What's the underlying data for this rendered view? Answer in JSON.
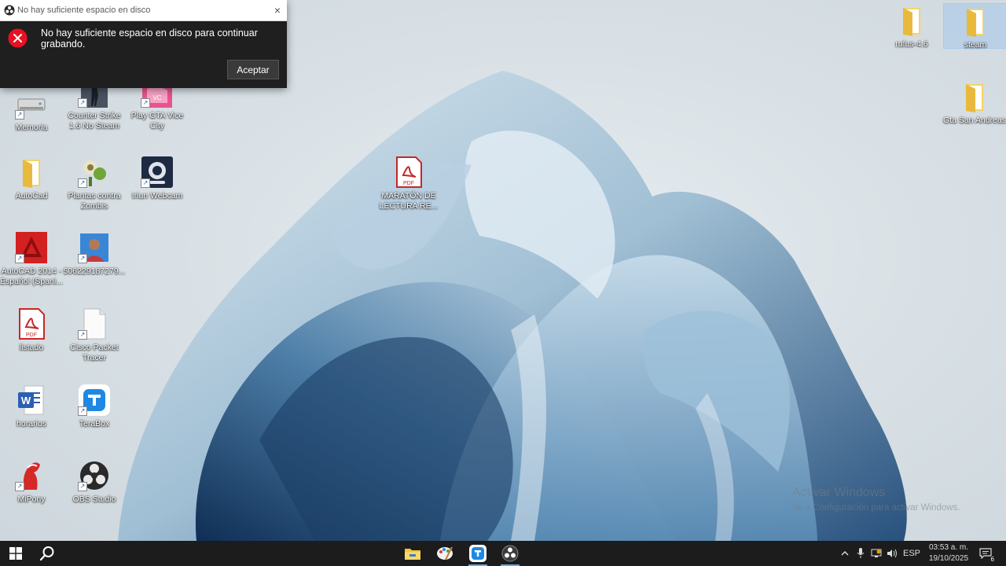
{
  "dialog": {
    "title": "No hay suficiente espacio en disco",
    "message": "No hay suficiente espacio en disco para continuar grabando.",
    "ok_label": "Aceptar",
    "close_glyph": "×"
  },
  "desktop": {
    "icons": [
      {
        "label": "Memoria",
        "icon": "drive-icon"
      },
      {
        "label": "Counter Strike 1.6 No Steam",
        "icon": "counter-strike-icon"
      },
      {
        "label": "Play GTA Vice City",
        "icon": "gta-vice-city-icon"
      },
      {
        "label": "AutoCad",
        "icon": "folder-icon"
      },
      {
        "label": "Plantas contra Zombis",
        "icon": "plants-vs-zombies-icon"
      },
      {
        "label": "Iriun Webcam",
        "icon": "webcam-icon"
      },
      {
        "label": "MARATÓN DE LECTURA RE...",
        "icon": "pdf-icon"
      },
      {
        "label": "AutoCAD 2014 - Español (Spani...",
        "icon": "autocad-icon"
      },
      {
        "label": "506229187279...",
        "icon": "photo-icon"
      },
      {
        "label": "listado",
        "icon": "pdf-icon"
      },
      {
        "label": "Cisco Packet Tracer",
        "icon": "blank-file-icon"
      },
      {
        "label": "horarios",
        "icon": "word-icon"
      },
      {
        "label": "TeraBox",
        "icon": "terabox-icon"
      },
      {
        "label": "MiPony",
        "icon": "mipony-icon"
      },
      {
        "label": "OBS Studio",
        "icon": "obs-icon"
      },
      {
        "label": "rufus-4.6",
        "icon": "folder-icon"
      },
      {
        "label": "steam",
        "icon": "folder-icon"
      },
      {
        "label": "Gta San Andreas",
        "icon": "folder-icon"
      }
    ]
  },
  "watermark": {
    "line1": "Activar Windows",
    "line2": "Ve a Configuración para activar Windows."
  },
  "taskbar": {
    "language": "ESP",
    "time": "03:53 a. m.",
    "date": "19/10/2025",
    "notification_count": "6"
  },
  "colors": {
    "taskbar": "#1c1c1c",
    "dialog_body": "#1f1f1f",
    "error_red": "#e81123",
    "accent": "#6aa7e8"
  }
}
